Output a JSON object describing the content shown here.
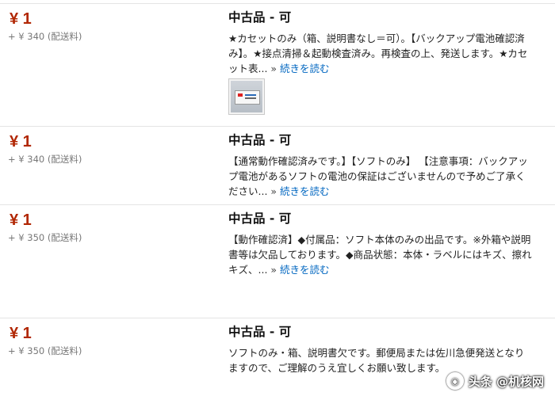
{
  "listings": [
    {
      "price": "¥ 1",
      "shipping_amount": "+ ¥ 340",
      "shipping_note": "(配送料)",
      "condition": "中古品 - 可",
      "description": "★カセットのみ（箱、説明書なし＝可）。【バックアップ電池確認済み】。★接点清掃＆起動検査済み。再検査の上、発送します。★カセット表...",
      "more_separator": "»",
      "more_label": "続きを読む"
    },
    {
      "price": "¥ 1",
      "shipping_amount": "+ ¥ 340",
      "shipping_note": "(配送料)",
      "condition": "中古品 - 可",
      "description": "【通常動作確認済みです。】【ソフトのみ】 【注意事項：バックアップ電池があるソフトの電池の保証はございませんので予めご了承ください...",
      "more_separator": "»",
      "more_label": "続きを読む"
    },
    {
      "price": "¥ 1",
      "shipping_amount": "+ ¥ 350",
      "shipping_note": "(配送料)",
      "condition": "中古品 - 可",
      "description": "【動作確認済】◆付属品：ソフト本体のみの出品です。※外箱や説明書等は欠品しております。◆商品状態：本体・ラベルにはキズ、擦れキズ、...",
      "more_separator": "»",
      "more_label": "続きを読む"
    },
    {
      "price": "¥ 1",
      "shipping_amount": "+ ¥ 350",
      "shipping_note": "(配送料)",
      "condition": "中古品 - 可",
      "description": "ソフトのみ・箱、説明書欠です。郵便局または佐川急便発送となりますので、ご理解のうえ宜しくお願い致します。"
    }
  ],
  "thumbnail": {
    "icon": "cartridge-thumbnail"
  },
  "watermark": {
    "text": "头条 @机核网",
    "icon": "camera-icon"
  }
}
